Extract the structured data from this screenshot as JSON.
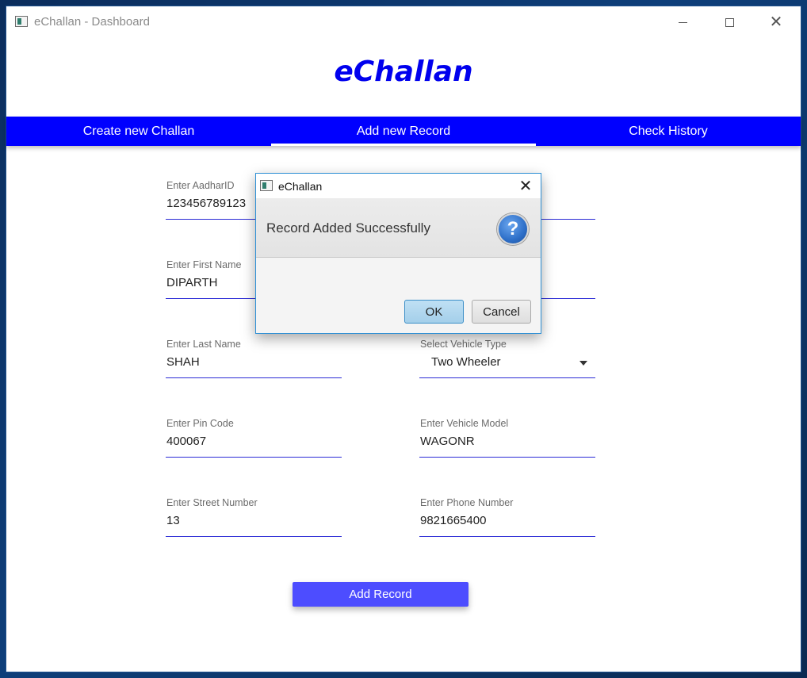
{
  "window": {
    "title": "eChallan - Dashboard",
    "icons": {
      "minimize": "minimize-icon",
      "maximize": "maximize-icon",
      "close": "close-icon"
    }
  },
  "app": {
    "title": "eChallan"
  },
  "tabs": [
    {
      "label": "Create new Challan",
      "active": false
    },
    {
      "label": "Add new Record",
      "active": true
    },
    {
      "label": "Check History",
      "active": false
    }
  ],
  "form": {
    "aadhar": {
      "label": "Enter AadharID",
      "value": "123456789123"
    },
    "first_name": {
      "label": "Enter First Name",
      "value": "DIPARTH"
    },
    "last_name": {
      "label": "Enter Last Name",
      "value": "SHAH"
    },
    "vehicle_type": {
      "label": "Select Vehicle Type",
      "value": "Two Wheeler"
    },
    "pin_code": {
      "label": "Enter Pin Code",
      "value": "400067"
    },
    "vehicle_model": {
      "label": "Enter Vehicle Model",
      "value": "WAGONR"
    },
    "street_number": {
      "label": "Enter Street Number",
      "value": "13"
    },
    "phone_number": {
      "label": "Enter Phone Number",
      "value": "9821665400"
    },
    "submit_label": "Add Record"
  },
  "dialog": {
    "title": "eChallan",
    "message": "Record Added Successfully",
    "icon": "question-icon",
    "ok_label": "OK",
    "cancel_label": "Cancel"
  },
  "colors": {
    "accent_blue": "#0000ff",
    "title_blue": "#0000ee",
    "button_blue": "#4d4dff",
    "dialog_border": "#2d8fd5"
  }
}
